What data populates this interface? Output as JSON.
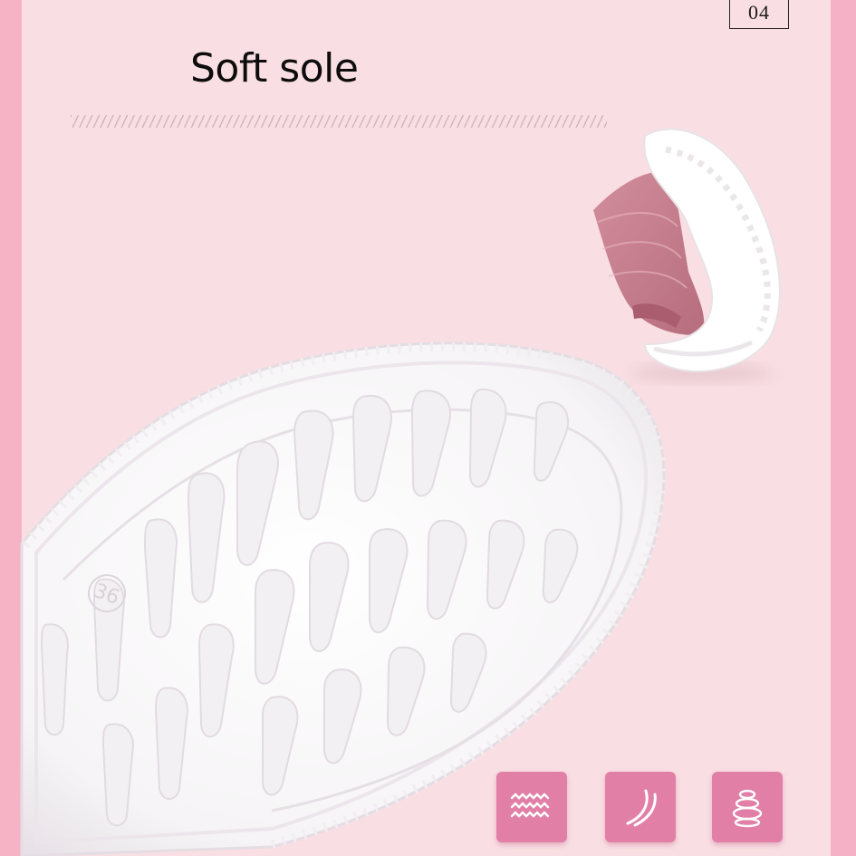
{
  "page_number": "04",
  "title": "Soft sole",
  "sole_size_mark": "36",
  "colors": {
    "background": "#f9dfe3",
    "frame": "#f6b3c6",
    "icon_tile": "#e17fa7",
    "shoe_upper": "#c98593",
    "sole": "#ffffff"
  },
  "feature_icons": [
    {
      "icon": "wave-layers-icon"
    },
    {
      "icon": "flex-curve-icon"
    },
    {
      "icon": "spring-stack-icon"
    }
  ]
}
